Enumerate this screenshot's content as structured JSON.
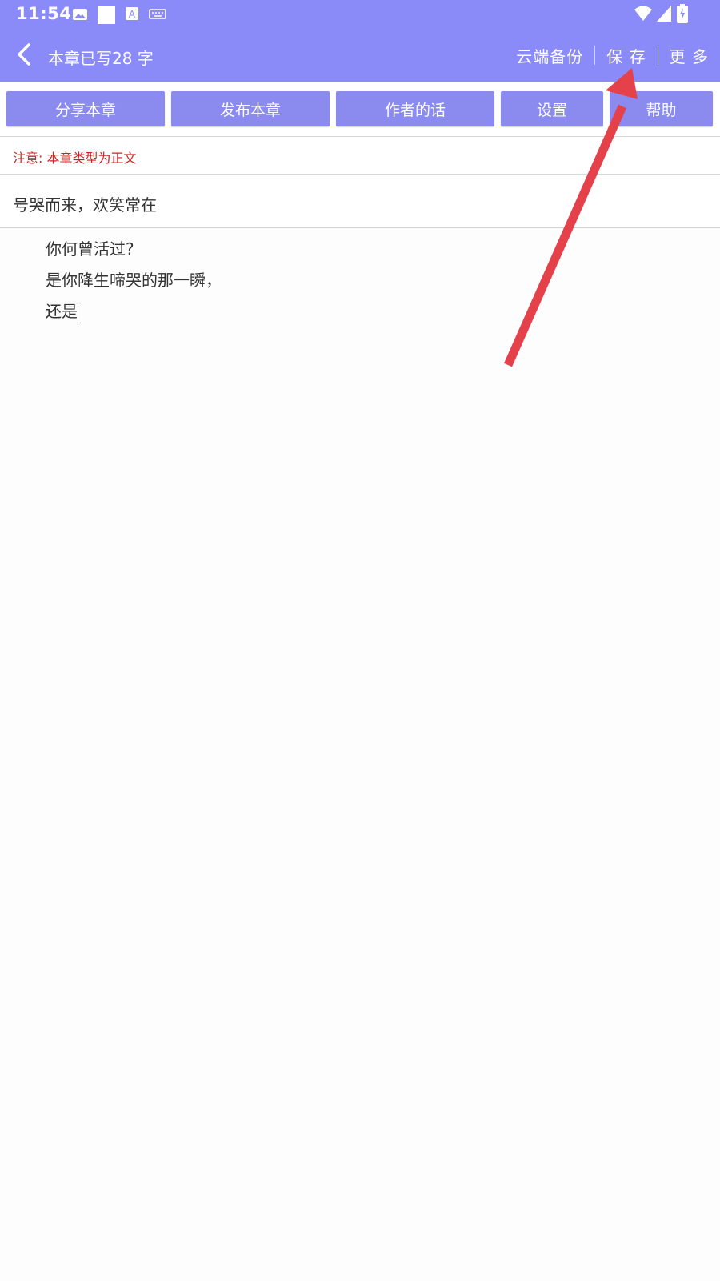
{
  "status_bar": {
    "time": "11:54",
    "icons": [
      "image-icon",
      "square-notification-icon",
      "a-notification-icon",
      "keyboard-icon",
      "wifi-icon",
      "signal-icon",
      "battery-charging-icon"
    ]
  },
  "header": {
    "title": "本章已写28 字",
    "actions": {
      "cloud_backup": "云端备份",
      "save": "保 存",
      "more": "更 多"
    }
  },
  "toolbar": {
    "share": "分享本章",
    "publish": "发布本章",
    "author_note": "作者的话",
    "settings": "设置",
    "help": "帮助"
  },
  "notice": "注意: 本章类型为正文",
  "chapter": {
    "title": "号哭而来，欢笑常在",
    "lines": [
      "你何曾活过?",
      "是你降生啼哭的那一瞬，",
      "还是"
    ]
  },
  "colors": {
    "header_bg": "#8a8af8",
    "button_bg": "#8a8aef",
    "notice_text": "#d02020",
    "annotation_arrow": "#e5414a"
  }
}
